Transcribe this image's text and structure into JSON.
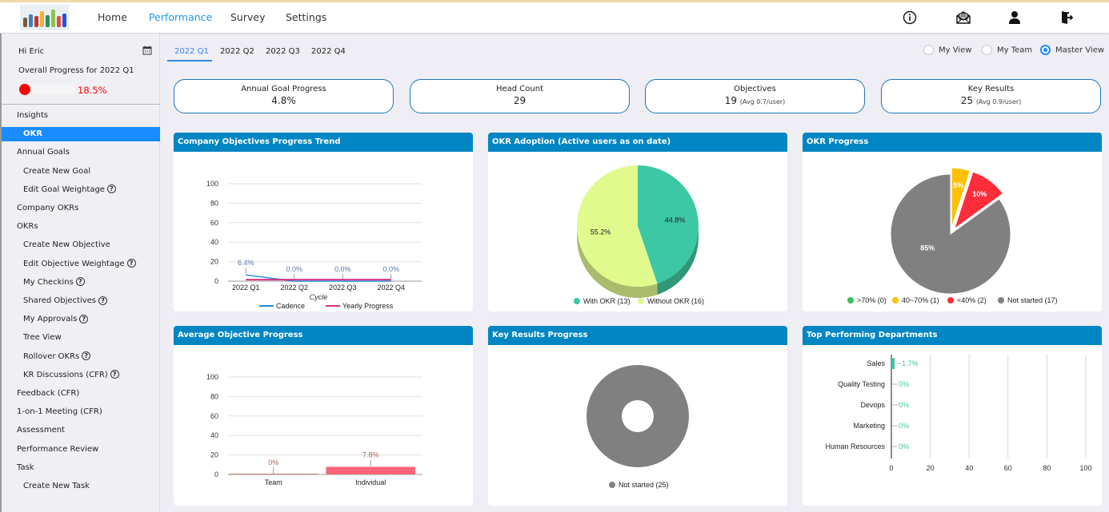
{
  "topnav": {
    "items": [
      {
        "label": "Home",
        "active": false
      },
      {
        "label": "Performance",
        "active": true
      },
      {
        "label": "Survey",
        "active": false
      },
      {
        "label": "Settings",
        "active": false
      }
    ],
    "icons": [
      "info-icon",
      "mail-icon",
      "user-icon",
      "logout-icon"
    ]
  },
  "sidebar": {
    "greeting": "Hi Eric",
    "overall_label": "Overall Progress for 2022 Q1",
    "overall_value": "18.5%",
    "overall_fraction": 0.185,
    "items": [
      {
        "label": "Insights",
        "level": 1,
        "help": false,
        "active": false
      },
      {
        "label": "OKR",
        "level": 2,
        "help": false,
        "active": true
      },
      {
        "label": "Annual Goals",
        "level": 1,
        "help": false,
        "active": false
      },
      {
        "label": "Create New Goal",
        "level": 2,
        "help": false,
        "active": false
      },
      {
        "label": "Edit Goal Weightage",
        "level": 2,
        "help": true,
        "active": false
      },
      {
        "label": "Company OKRs",
        "level": 1,
        "help": false,
        "active": false
      },
      {
        "label": "OKRs",
        "level": 1,
        "help": false,
        "active": false
      },
      {
        "label": "Create New Objective",
        "level": 2,
        "help": false,
        "active": false
      },
      {
        "label": "Edit Objective Weightage",
        "level": 2,
        "help": true,
        "active": false
      },
      {
        "label": "My Checkins",
        "level": 2,
        "help": true,
        "active": false
      },
      {
        "label": "Shared Objectives",
        "level": 2,
        "help": true,
        "active": false
      },
      {
        "label": "My Approvals",
        "level": 2,
        "help": true,
        "active": false
      },
      {
        "label": "Tree View",
        "level": 2,
        "help": false,
        "active": false
      },
      {
        "label": "Rollover OKRs",
        "level": 2,
        "help": true,
        "active": false
      },
      {
        "label": "KR Discussions (CFR)",
        "level": 2,
        "help": true,
        "active": false
      },
      {
        "label": "Feedback (CFR)",
        "level": 1,
        "help": false,
        "active": false
      },
      {
        "label": "1-on-1 Meeting (CFR)",
        "level": 1,
        "help": false,
        "active": false
      },
      {
        "label": "Assessment",
        "level": 1,
        "help": false,
        "active": false
      },
      {
        "label": "Performance Review",
        "level": 1,
        "help": false,
        "active": false
      },
      {
        "label": "Task",
        "level": 1,
        "help": false,
        "active": false
      },
      {
        "label": "Create New Task",
        "level": 2,
        "help": false,
        "active": false
      }
    ]
  },
  "quarter_tabs": [
    {
      "label": "2022 Q1",
      "active": true
    },
    {
      "label": "2022 Q2",
      "active": false
    },
    {
      "label": "2022 Q3",
      "active": false
    },
    {
      "label": "2022 Q4",
      "active": false
    }
  ],
  "view_options": [
    {
      "label": "My View",
      "selected": false
    },
    {
      "label": "My Team",
      "selected": false
    },
    {
      "label": "Master View",
      "selected": true
    }
  ],
  "summary_cards": [
    {
      "title": "Annual Goal Progress",
      "value": "4.8%",
      "sub": ""
    },
    {
      "title": "Head Count",
      "value": "29",
      "sub": ""
    },
    {
      "title": "Objectives",
      "value": "19",
      "sub": "(Avg 0.7/user)"
    },
    {
      "title": "Key Results",
      "value": "25",
      "sub": "(Avg 0.9/user)"
    }
  ],
  "colors": {
    "accent": "#0086c3",
    "active_nav": "#2196f3",
    "sidebar_active": "#1a8cff",
    "progress_red": "#ff0000"
  },
  "chart_data": [
    {
      "type": "line",
      "title": "Company Objectives Progress Trend",
      "categories": [
        "2022 Q1",
        "2022 Q2",
        "2022 Q3",
        "2022 Q4"
      ],
      "xlabel": "Cycle",
      "ylabel": "",
      "ylim": [
        0,
        100
      ],
      "yticks": [
        0,
        20,
        40,
        60,
        80,
        100
      ],
      "grid": true,
      "legend": "bottom",
      "series": [
        {
          "name": "Cadence",
          "color": "#1f8dd6",
          "values": [
            6.4,
            0,
            0,
            0
          ],
          "labels": [
            "6.4%",
            "0.0%",
            "0.0%",
            "0.0%"
          ]
        },
        {
          "name": "Yearly Progress",
          "color": "#d63384",
          "values": [
            1.5,
            1.5,
            1.5,
            1.5
          ]
        }
      ]
    },
    {
      "type": "pie",
      "title": "OKR Adoption (Active users as on date)",
      "legend": "bottom",
      "slices": [
        {
          "name": "With OKR (13)",
          "value": 44.8,
          "label": "44.8%",
          "color": "#3cc8a4",
          "side": "#2f9878"
        },
        {
          "name": "Without OKR (16)",
          "value": 55.2,
          "label": "55.2%",
          "color": "#e1fa8e",
          "side": "#aabb6c"
        }
      ]
    },
    {
      "type": "pie",
      "title": "OKR Progress",
      "legend": "bottom",
      "slices": [
        {
          "name": ">70% (0)",
          "value": 0,
          "label": "",
          "color": "#3dbf5f"
        },
        {
          "name": "40~70% (1)",
          "value": 5,
          "label": "5%",
          "color": "#ffc107"
        },
        {
          "name": "<40% (2)",
          "value": 10,
          "label": "10%",
          "color": "#ff2d3a"
        },
        {
          "name": "Not started (17)",
          "value": 85,
          "label": "85%",
          "color": "#808080"
        }
      ]
    },
    {
      "type": "bar",
      "title": "Average Objective Progress",
      "categories": [
        "Team",
        "Individual"
      ],
      "values": [
        0,
        7.8
      ],
      "labels": [
        "0%",
        "7.8%"
      ],
      "colors": [
        "#c4896b",
        "#ff6479"
      ],
      "ylim": [
        0,
        100
      ],
      "yticks": [
        0,
        20,
        40,
        60,
        80,
        100
      ],
      "grid": true
    },
    {
      "type": "pie",
      "title": "Key Results Progress",
      "legend": "bottom",
      "donut": true,
      "slices": [
        {
          "name": "Not started (25)",
          "value": 100,
          "color": "#808080"
        }
      ]
    },
    {
      "type": "bar",
      "orientation": "horizontal",
      "title": "Top Performing Departments",
      "categories": [
        "Sales",
        "Quality Testing",
        "Devops",
        "Marketing",
        "Human Resources"
      ],
      "values": [
        1.7,
        0,
        0,
        0,
        0
      ],
      "labels": [
        "1.7%",
        "0%",
        "0%",
        "0%",
        "0%"
      ],
      "color": "#3cc8a4",
      "xlim": [
        0,
        100
      ],
      "xticks": [
        0,
        20,
        40,
        60,
        80,
        100
      ],
      "grid": true
    }
  ]
}
